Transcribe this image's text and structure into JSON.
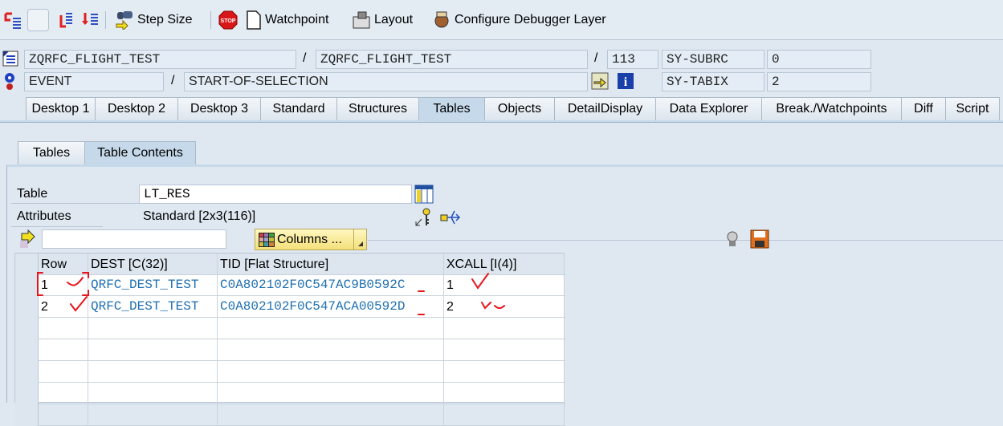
{
  "toolbar": {
    "step_size": "Step Size",
    "watchpoint": "Watchpoint",
    "layout": "Layout",
    "configure": "Configure Debugger Layer"
  },
  "context": {
    "program": "ZQRFC_FLIGHT_TEST",
    "include": "ZQRFC_FLIGHT_TEST",
    "line": "113",
    "event_type": "EVENT",
    "event": "START-OF-SELECTION",
    "sy_subrc_label": "SY-SUBRC",
    "sy_subrc": "0",
    "sy_tabix_label": "SY-TABIX",
    "sy_tabix": "2"
  },
  "tabs": [
    "Desktop 1",
    "Desktop 2",
    "Desktop 3",
    "Standard",
    "Structures",
    "Tables",
    "Objects",
    "DetailDisplay",
    "Data Explorer",
    "Break./Watchpoints",
    "Diff",
    "Script"
  ],
  "subtabs": [
    "Tables",
    "Table Contents"
  ],
  "table_info": {
    "table_label": "Table",
    "table_value": "LT_RES",
    "attributes_label": "Attributes",
    "attributes_value": "Standard [2x3(116)]",
    "columns_button": "Columns ...",
    "filter_value": ""
  },
  "grid": {
    "headers": [
      "Row",
      "DEST [C(32)]",
      "TID [Flat Structure]",
      "XCALL [I(4)]"
    ],
    "rows": [
      [
        "1",
        "QRFC_DEST_TEST",
        "C0A802102F0C547AC9B0592C",
        "1"
      ],
      [
        "2",
        "QRFC_DEST_TEST",
        "C0A802102F0C547ACA00592D",
        "2"
      ]
    ]
  },
  "colors": {
    "annotation": "#e8141c",
    "link_text": "#1e6fb0"
  }
}
